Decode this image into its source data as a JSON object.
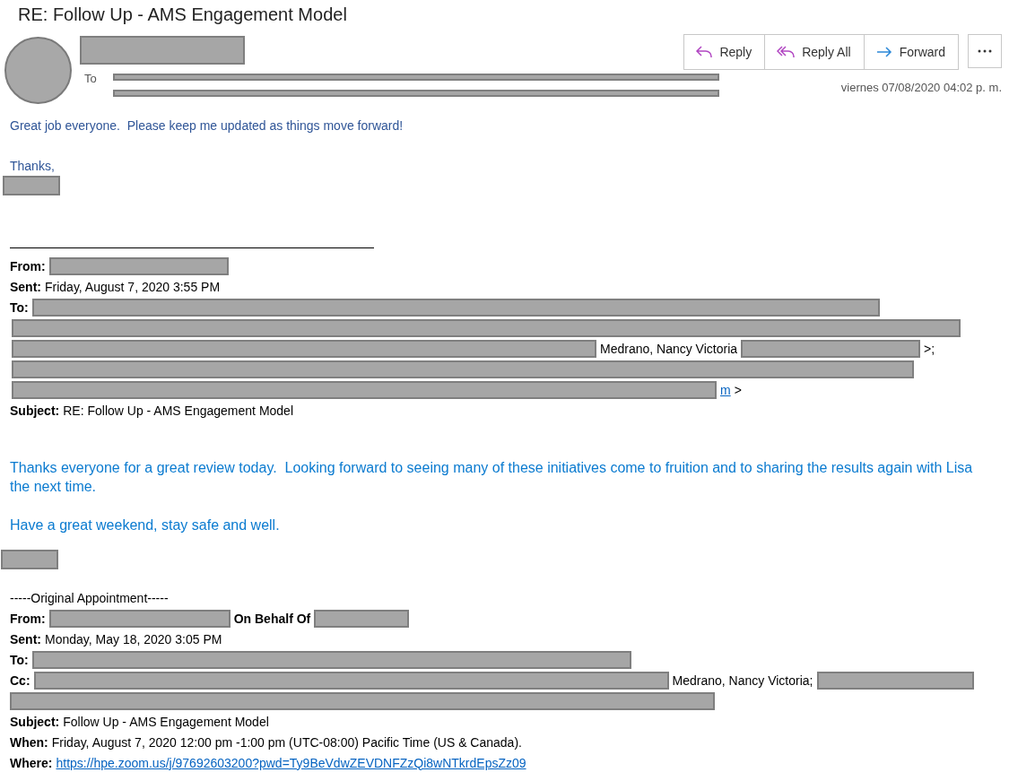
{
  "title": "RE: Follow Up - AMS Engagement Model",
  "header": {
    "to_label": "To",
    "date": "viernes 07/08/2020 04:02 p. m.",
    "actions": [
      {
        "label": "Reply",
        "kind": "reply"
      },
      {
        "label": "Reply All",
        "kind": "reply_all"
      },
      {
        "label": "Forward",
        "kind": "forward"
      }
    ]
  },
  "reply_body": [
    "Great job everyone.  Please keep me updated as things move forward!",
    "Thanks,"
  ],
  "forwarded": [
    [
      {
        "kind": "label",
        "text": "From:"
      },
      {
        "kind": "redacted"
      }
    ],
    [
      {
        "kind": "label",
        "text": "Sent:"
      },
      {
        "kind": "text",
        "text": "Friday,  August 7, 2020 3:55 PM"
      }
    ],
    [
      {
        "kind": "label",
        "text": "To:"
      },
      {
        "kind": "redacted"
      }
    ],
    [
      {
        "kind": "redacted"
      }
    ],
    [
      {
        "kind": "redacted"
      },
      {
        "kind": "text",
        "text": "Medrano, Nancy Victoria"
      },
      {
        "kind": "redacted"
      },
      {
        "kind": "text",
        "text": ">;"
      }
    ],
    [
      {
        "kind": "redacted"
      }
    ],
    [
      {
        "kind": "redacted"
      },
      {
        "kind": "link",
        "text": "m"
      },
      {
        "kind": "text",
        "text": ">"
      }
    ],
    [
      {
        "kind": "label",
        "text": "Subject:"
      },
      {
        "kind": "text",
        "text": "RE: Follow Up - AMS Engagement Model"
      }
    ]
  ],
  "message": [
    "Thanks everyone for a great review today.  Looking forward to seeing many of these initiatives come to fruition and to sharing the results again with Lisa the next time.",
    "Have a great weekend, stay safe and well."
  ],
  "appointment": [
    [
      {
        "kind": "text",
        "text": "-----Original Appointment-----"
      }
    ],
    [
      {
        "kind": "label",
        "text": "From:"
      },
      {
        "kind": "redacted"
      },
      {
        "kind": "label",
        "text": "On Behalf Of"
      },
      {
        "kind": "redacted"
      }
    ],
    [
      {
        "kind": "label",
        "text": "Sent:"
      },
      {
        "kind": "text",
        "text": "Monday, May 18, 2020 3:05 PM"
      }
    ],
    [
      {
        "kind": "label",
        "text": "To:"
      },
      {
        "kind": "redacted"
      }
    ],
    [
      {
        "kind": "label",
        "text": "Cc:"
      },
      {
        "kind": "redacted"
      },
      {
        "kind": "text",
        "text": "Medrano, Nancy Victoria;"
      },
      {
        "kind": "redacted"
      }
    ],
    [
      {
        "kind": "redacted"
      }
    ],
    [
      {
        "kind": "label",
        "text": "Subject:"
      },
      {
        "kind": "text",
        "text": "Follow Up - AMS Engagement Model"
      }
    ],
    [
      {
        "kind": "label",
        "text": "When:"
      },
      {
        "kind": "text",
        "text": "Friday, August 7, 2020 12:00 pm -1:00 pm (UTC-08:00) Pacific Time (US & Canada)."
      }
    ],
    [
      {
        "kind": "label",
        "text": "Where:"
      },
      {
        "kind": "link",
        "text": "https://hpe.zoom.us/j/97692603200?pwd=Ty9BeVdwZEVDNFZzQi8wNTkrdEpsZz09"
      }
    ]
  ]
}
